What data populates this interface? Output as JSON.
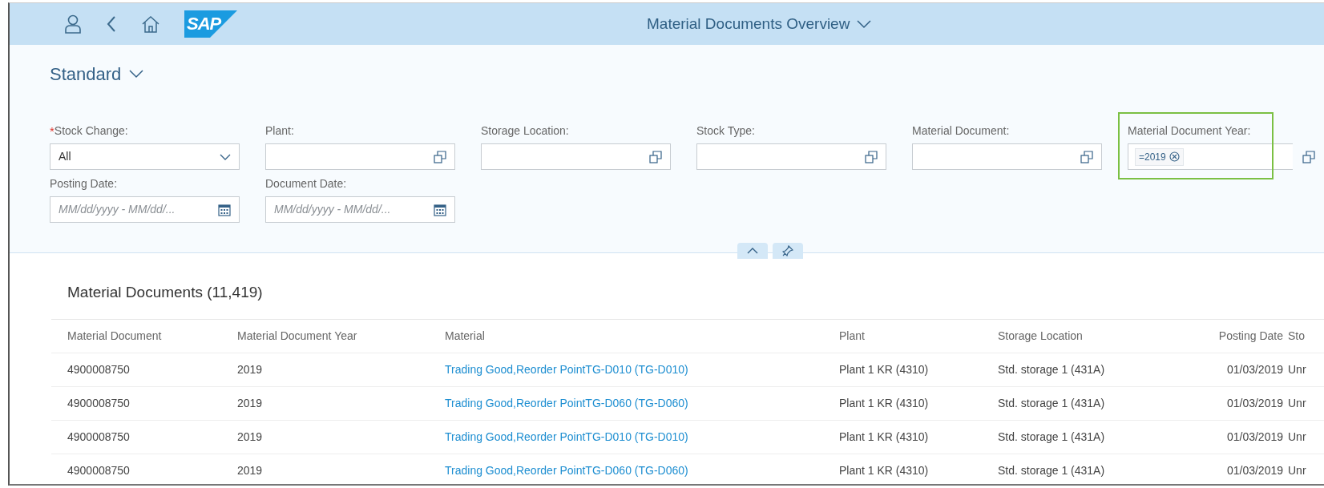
{
  "shell": {
    "logo_text": "SAP",
    "title": "Material Documents Overview"
  },
  "variant": {
    "label": "Standard"
  },
  "filters": [
    {
      "label": "Stock Change:",
      "required_mark": "*",
      "kind": "select",
      "value": "All",
      "focused": false
    },
    {
      "label": "Plant:",
      "kind": "value_help",
      "focused": false
    },
    {
      "label": "Storage Location:",
      "kind": "value_help",
      "focused": false
    },
    {
      "label": "Stock Type:",
      "kind": "value_help",
      "focused": false
    },
    {
      "label": "Material Document:",
      "kind": "value_help",
      "focused": false
    },
    {
      "label": "Material Document Year:",
      "kind": "value_help",
      "tokens": [
        "=2019"
      ],
      "focused": true
    },
    {
      "label": "Posting Date:",
      "kind": "date",
      "placeholder": "MM/dd/yyyy - MM/dd/...",
      "focused": false
    },
    {
      "label": "Document Date:",
      "kind": "date",
      "placeholder": "MM/dd/yyyy - MM/dd/...",
      "focused": false
    }
  ],
  "table": {
    "title": "Material Documents (11,419)",
    "columns": [
      {
        "label": "Material Document",
        "kind": "text"
      },
      {
        "label": "Material Document Year",
        "kind": "text"
      },
      {
        "label": "Material",
        "kind": "link"
      },
      {
        "label": "Plant",
        "kind": "text"
      },
      {
        "label": "Storage Location",
        "kind": "text"
      },
      {
        "label": "Posting Date",
        "kind": "date"
      },
      {
        "label": "Sto",
        "kind": "text"
      }
    ],
    "rows": [
      [
        "4900008750",
        "2019",
        "Trading Good,Reorder PointTG-D010 (TG-D010)",
        "Plant 1 KR (4310)",
        "Std. storage 1 (431A)",
        "01/03/2019",
        "Unr"
      ],
      [
        "4900008750",
        "2019",
        "Trading Good,Reorder PointTG-D060 (TG-D060)",
        "Plant 1 KR (4310)",
        "Std. storage 1 (431A)",
        "01/03/2019",
        "Unr"
      ],
      [
        "4900008750",
        "2019",
        "Trading Good,Reorder PointTG-D010 (TG-D010)",
        "Plant 1 KR (4310)",
        "Std. storage 1 (431A)",
        "01/03/2019",
        "Unr"
      ],
      [
        "4900008750",
        "2019",
        "Trading Good,Reorder PointTG-D060 (TG-D060)",
        "Plant 1 KR (4310)",
        "Std. storage 1 (431A)",
        "01/03/2019",
        "Unr"
      ]
    ]
  }
}
